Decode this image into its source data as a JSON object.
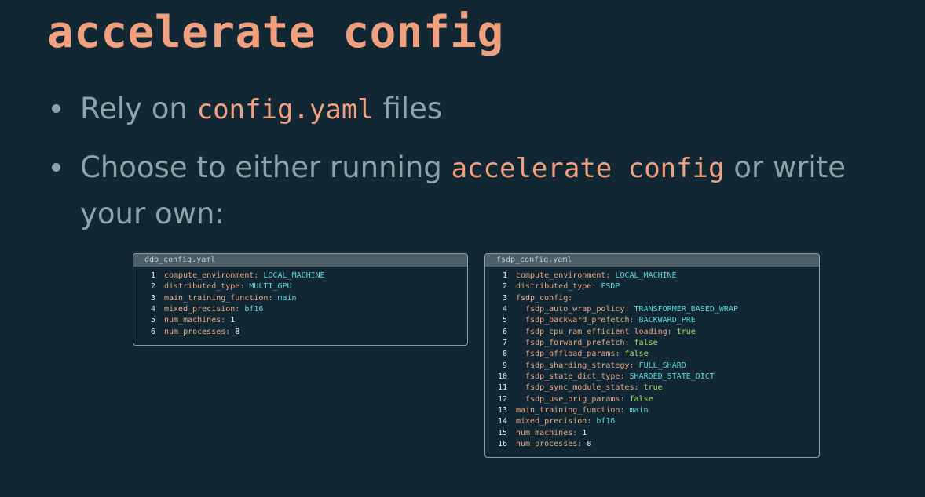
{
  "title": "accelerate config",
  "bullets": [
    {
      "text_before": "Rely on",
      "code": "config.yaml",
      "text_after": "files"
    },
    {
      "text_before": "Choose to either running",
      "code": "accelerate config",
      "text_after": "or write your own:"
    }
  ],
  "ddp": {
    "filename": "ddp_config.yaml",
    "lines": [
      {
        "n": "1",
        "indent": "",
        "key": "compute_environment",
        "value": "LOCAL_MACHINE",
        "kind": "v"
      },
      {
        "n": "2",
        "indent": "",
        "key": "distributed_type",
        "value": "MULTI_GPU",
        "kind": "v"
      },
      {
        "n": "3",
        "indent": "",
        "key": "main_training_function",
        "value": "main",
        "kind": "v"
      },
      {
        "n": "4",
        "indent": "",
        "key": "mixed_precision",
        "value": "bf16",
        "kind": "v"
      },
      {
        "n": "5",
        "indent": "",
        "key": "num_machines",
        "value": "1",
        "kind": "n"
      },
      {
        "n": "6",
        "indent": "",
        "key": "num_processes",
        "value": "8",
        "kind": "n"
      }
    ]
  },
  "fsdp": {
    "filename": "fsdp_config.yaml",
    "lines": [
      {
        "n": "1",
        "indent": "",
        "key": "compute_environment",
        "value": "LOCAL_MACHINE",
        "kind": "v"
      },
      {
        "n": "2",
        "indent": "",
        "key": "distributed_type",
        "value": "FSDP",
        "kind": "v"
      },
      {
        "n": "3",
        "indent": "",
        "key": "fsdp_config",
        "value": "",
        "kind": "v"
      },
      {
        "n": "4",
        "indent": "  ",
        "key": "fsdp_auto_wrap_policy",
        "value": "TRANSFORMER_BASED_WRAP",
        "kind": "v"
      },
      {
        "n": "5",
        "indent": "  ",
        "key": "fsdp_backward_prefetch",
        "value": "BACKWARD_PRE",
        "kind": "v"
      },
      {
        "n": "6",
        "indent": "  ",
        "key": "fsdp_cpu_ram_efficient_loading",
        "value": "true",
        "kind": "b"
      },
      {
        "n": "7",
        "indent": "  ",
        "key": "fsdp_forward_prefetch",
        "value": "false",
        "kind": "b"
      },
      {
        "n": "8",
        "indent": "  ",
        "key": "fsdp_offload_params",
        "value": "false",
        "kind": "b"
      },
      {
        "n": "9",
        "indent": "  ",
        "key": "fsdp_sharding_strategy",
        "value": "FULL_SHARD",
        "kind": "v"
      },
      {
        "n": "10",
        "indent": "  ",
        "key": "fsdp_state_dict_type",
        "value": "SHARDED_STATE_DICT",
        "kind": "v"
      },
      {
        "n": "11",
        "indent": "  ",
        "key": "fsdp_sync_module_states",
        "value": "true",
        "kind": "b"
      },
      {
        "n": "12",
        "indent": "  ",
        "key": "fsdp_use_orig_params",
        "value": "false",
        "kind": "b"
      },
      {
        "n": "13",
        "indent": "",
        "key": "main_training_function",
        "value": "main",
        "kind": "v"
      },
      {
        "n": "14",
        "indent": "",
        "key": "mixed_precision",
        "value": "bf16",
        "kind": "v"
      },
      {
        "n": "15",
        "indent": "",
        "key": "num_machines",
        "value": "1",
        "kind": "n"
      },
      {
        "n": "16",
        "indent": "",
        "key": "num_processes",
        "value": "8",
        "kind": "n"
      }
    ]
  }
}
